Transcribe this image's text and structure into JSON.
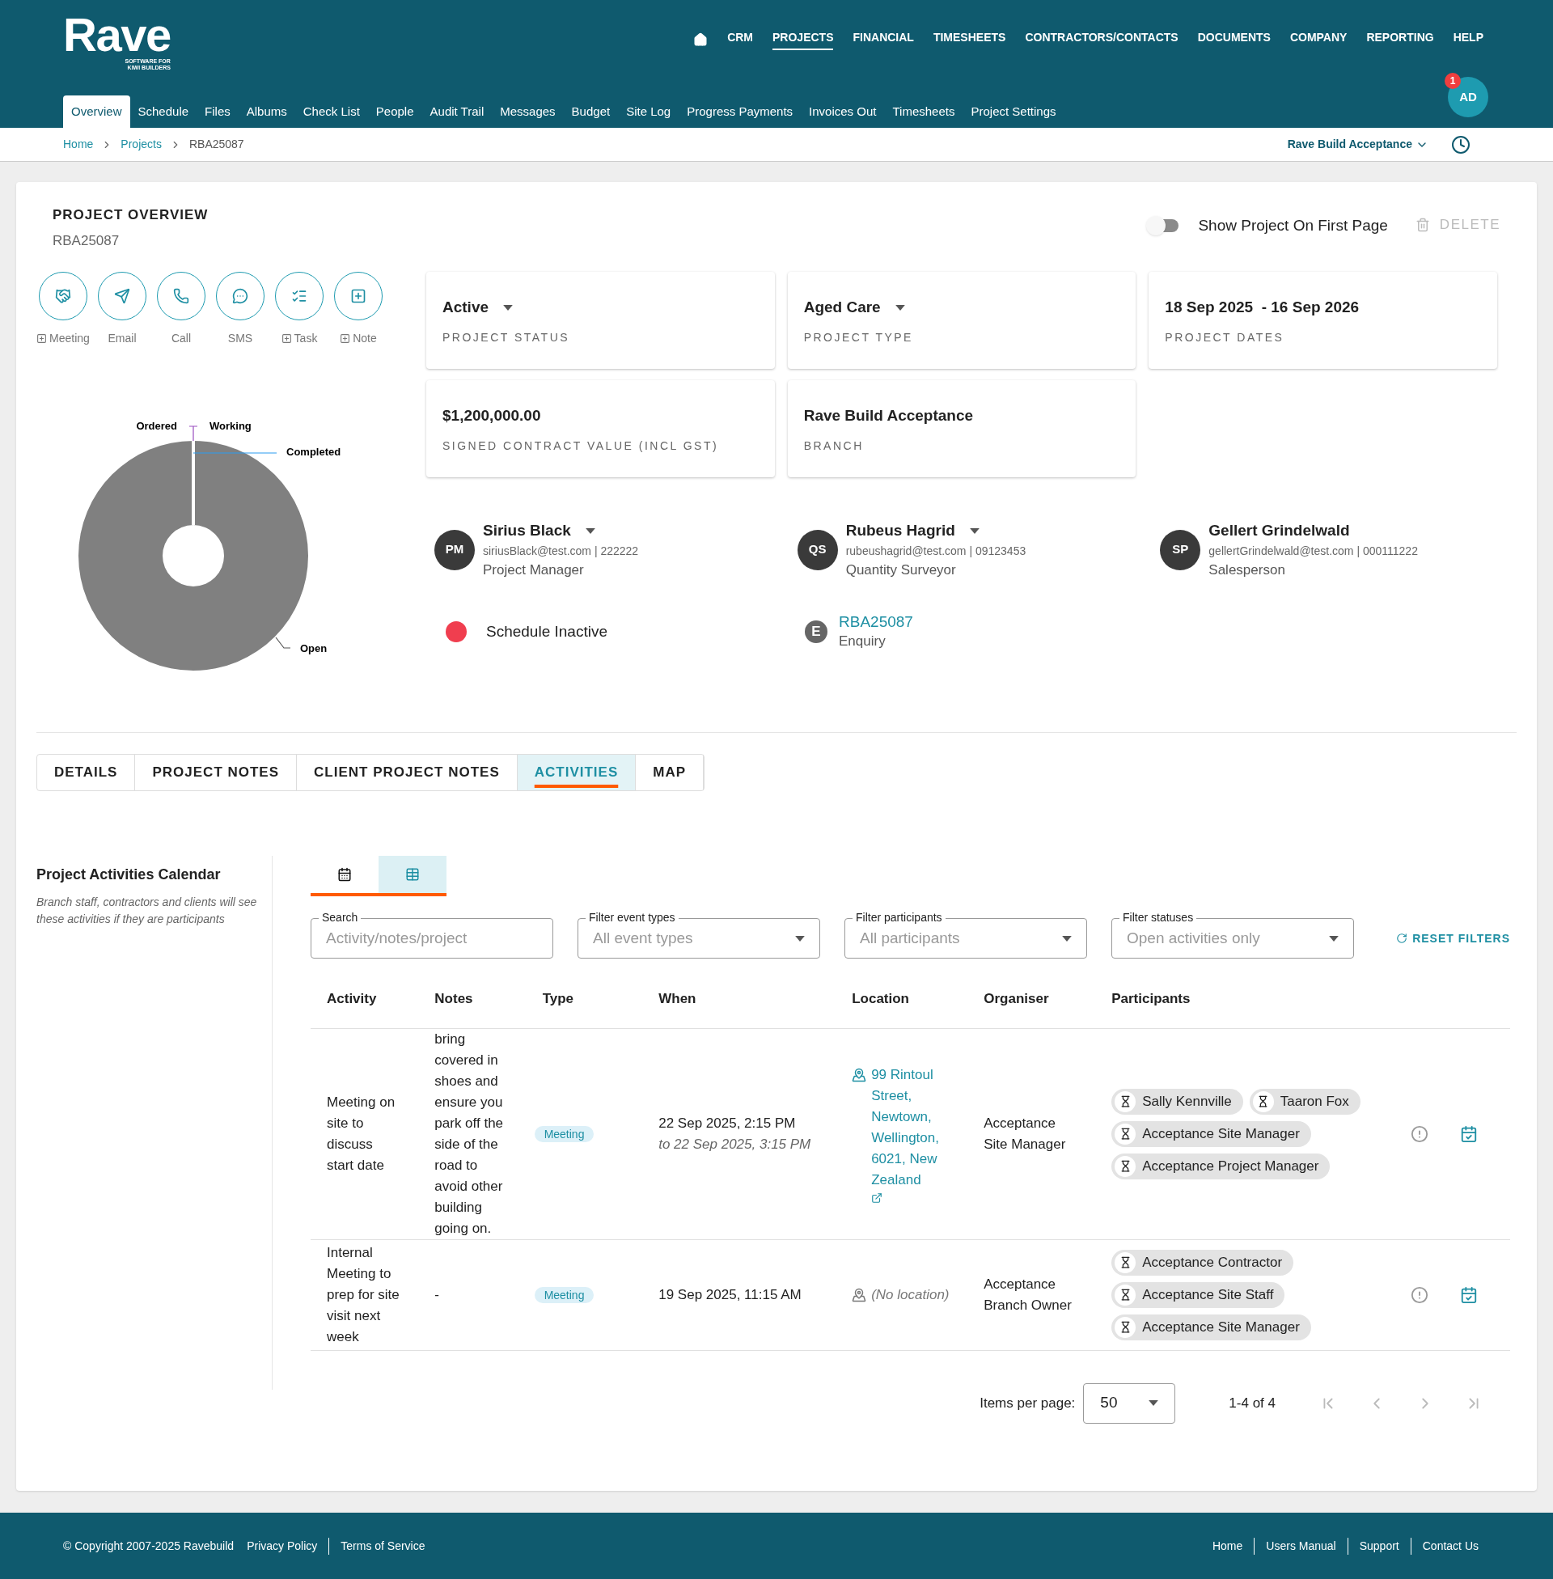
{
  "header": {
    "logo": {
      "name": "Rave",
      "tagline": "SOFTWARE FOR KIWI BUILDERS"
    },
    "top_nav": [
      {
        "kind": "home",
        "selected": false
      },
      {
        "kind": "text",
        "label": "CRM",
        "selected": false
      },
      {
        "kind": "text",
        "label": "PROJECTS",
        "selected": true
      },
      {
        "kind": "text",
        "label": "FINANCIAL",
        "selected": false
      },
      {
        "kind": "text",
        "label": "TIMESHEETS",
        "selected": false
      },
      {
        "kind": "text",
        "label": "CONTRACTORS/CONTACTS",
        "selected": false
      },
      {
        "kind": "text",
        "label": "DOCUMENTS",
        "selected": false
      },
      {
        "kind": "text",
        "label": "COMPANY",
        "selected": false
      },
      {
        "kind": "text",
        "label": "REPORTING",
        "selected": false
      },
      {
        "kind": "text",
        "label": "HELP",
        "selected": false
      }
    ],
    "sub_nav": [
      {
        "label": "Overview",
        "selected": true
      },
      {
        "label": "Schedule",
        "selected": false
      },
      {
        "label": "Files",
        "selected": false
      },
      {
        "label": "Albums",
        "selected": false
      },
      {
        "label": "Check List",
        "selected": false
      },
      {
        "label": "People",
        "selected": false
      },
      {
        "label": "Audit Trail",
        "selected": false
      },
      {
        "label": "Messages",
        "selected": false
      },
      {
        "label": "Budget",
        "selected": false
      },
      {
        "label": "Site Log",
        "selected": false
      },
      {
        "label": "Progress Payments",
        "selected": false
      },
      {
        "label": "Invoices Out",
        "selected": false
      },
      {
        "label": "Timesheets",
        "selected": false
      },
      {
        "label": "Project Settings",
        "selected": false
      }
    ],
    "avatar": {
      "initials": "AD",
      "badge": "1"
    }
  },
  "breadcrumbs": [
    "Home",
    "Projects",
    "RBA25087"
  ],
  "branch_select": "Rave Build Acceptance",
  "overview": {
    "title": "PROJECT OVERVIEW",
    "code": "RBA25087",
    "show_on_first_page": {
      "label": "Show Project On First Page",
      "on": false
    },
    "delete": {
      "label": "DELETE",
      "disabled": true
    },
    "quick_actions": [
      {
        "kind": "meeting",
        "label": "Meeting",
        "add": true
      },
      {
        "kind": "email",
        "label": "Email",
        "add": false
      },
      {
        "kind": "call",
        "label": "Call",
        "add": false
      },
      {
        "kind": "sms",
        "label": "SMS",
        "add": false
      },
      {
        "kind": "task",
        "label": "Task",
        "add": true
      },
      {
        "kind": "note",
        "label": "Note",
        "add": true
      }
    ],
    "donut": {
      "labels": [
        "Ordered",
        "Working",
        "Completed",
        "Open"
      ]
    },
    "cards": [
      {
        "value": "Active",
        "label": "PROJECT STATUS",
        "dropdown": true
      },
      {
        "value": "Aged Care",
        "label": "PROJECT TYPE",
        "dropdown": true
      },
      {
        "value": "18 Sep 2025  - 16 Sep 2026",
        "label": "PROJECT DATES",
        "dropdown": false
      },
      {
        "value": "$1,200,000.00",
        "label": "SIGNED CONTRACT VALUE (INCL GST)",
        "dropdown": false
      },
      {
        "value": "Rave Build Acceptance",
        "label": "BRANCH",
        "dropdown": false
      }
    ],
    "people": [
      {
        "initials": "PM",
        "name": "Sirius Black",
        "contact": "siriusBlack@test.com | 222222",
        "role": "Project Manager",
        "dropdown": true
      },
      {
        "initials": "QS",
        "name": "Rubeus Hagrid",
        "contact": "rubeushagrid@test.com | 09123453",
        "role": "Quantity Surveyor",
        "dropdown": true
      },
      {
        "initials": "SP",
        "name": "Gellert Grindelwald",
        "contact": "gellertGrindelwald@test.com | 000111222",
        "role": "Salesperson",
        "dropdown": false
      }
    ],
    "schedule": {
      "label": "Schedule Inactive",
      "color": "#f03e4f"
    },
    "enquiry": {
      "letter": "E",
      "link": "RBA25087",
      "label": "Enquiry"
    }
  },
  "tabs": [
    {
      "label": "DETAILS",
      "selected": false
    },
    {
      "label": "PROJECT NOTES",
      "selected": false
    },
    {
      "label": "CLIENT PROJECT NOTES",
      "selected": false
    },
    {
      "label": "ACTIVITIES",
      "selected": true
    },
    {
      "label": "MAP",
      "selected": false
    }
  ],
  "activities": {
    "title": "Project Activities Calendar",
    "description": "Branch staff, contractors and clients will see these activities if they are participants",
    "views": [
      {
        "kind": "calendar",
        "selected": false
      },
      {
        "kind": "list",
        "selected": true
      }
    ],
    "filters": [
      {
        "kind": "text",
        "label": "Search",
        "placeholder": "Activity/notes/project"
      },
      {
        "kind": "select",
        "label": "Filter event types",
        "placeholder": "All event types"
      },
      {
        "kind": "select",
        "label": "Filter participants",
        "placeholder": "All participants"
      },
      {
        "kind": "select",
        "label": "Filter statuses",
        "placeholder": "Open activities only"
      }
    ],
    "reset": "RESET FILTERS",
    "columns": [
      "Activity",
      "Notes",
      "Type",
      "When",
      "Location",
      "Organiser",
      "Participants"
    ],
    "rows": [
      {
        "activity": "Meeting on site to discuss start date",
        "notes": "bring covered in shoes and ensure you park off the side of the road to avoid other building going on.",
        "type": "Meeting",
        "when": "22 Sep 2025, 2:15 PM",
        "when_to": "to 22 Sep 2025, 3:15 PM",
        "location": {
          "text": "99 Rintoul Street, Newtown, Wellington, 6021, New Zealand",
          "link": true
        },
        "organiser": "Acceptance Site Manager",
        "participants": [
          "Sally Kennville",
          "Taaron Fox",
          "Acceptance Site Manager",
          "Acceptance Project Manager"
        ]
      },
      {
        "activity": "Internal Meeting to prep for site visit next week",
        "notes": "-",
        "type": "Meeting",
        "when": "19 Sep 2025, 11:15 AM",
        "location": {
          "text": "(No location)",
          "link": false
        },
        "organiser": "Acceptance Branch Owner",
        "participants": [
          "Acceptance Contractor",
          "Acceptance Site Staff",
          "Acceptance Site Manager"
        ]
      }
    ],
    "pagination": {
      "label": "Items per page:",
      "value": "50",
      "range": "1-4 of 4"
    }
  },
  "footer": {
    "copyright": "© Copyright 2007-2025 Ravebuild",
    "left_links": [
      "Privacy Policy",
      "Terms of Service"
    ],
    "right_links": [
      "Home",
      "Users Manual",
      "Support",
      "Contact Us"
    ]
  }
}
